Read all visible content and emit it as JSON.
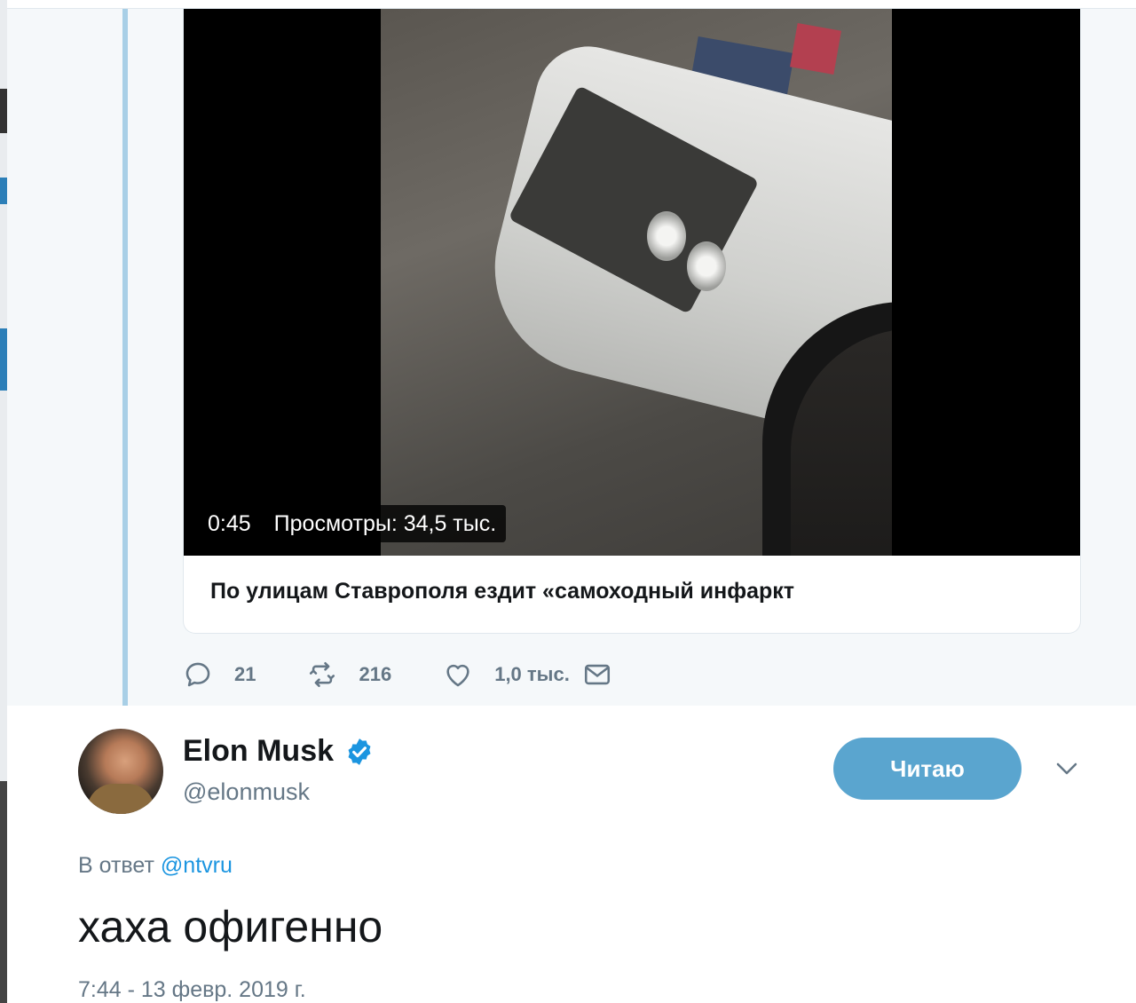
{
  "parent_tweet": {
    "video": {
      "duration": "0:45",
      "views": "Просмотры: 34,5 тыс."
    },
    "card_title": "По улицам Ставрополя ездит «самоходный инфаркт",
    "actions": {
      "replies": "21",
      "retweets": "216",
      "likes": "1,0 тыс."
    }
  },
  "main_tweet": {
    "author_name": "Elon Musk",
    "author_handle": "@elonmusk",
    "follow_label": "Читаю",
    "reply_prefix": "В ответ",
    "reply_mention": "@ntvru",
    "text": "хаха офигенно",
    "timestamp": "7:44 - 13 февр. 2019 г."
  },
  "icons": {
    "reply": "reply-icon",
    "retweet": "retweet-icon",
    "like": "heart-icon",
    "dm": "envelope-icon",
    "verified": "verified-badge-icon",
    "more": "chevron-down-icon"
  },
  "colors": {
    "accent": "#1b95e0",
    "follow_button": "#5aa5cf",
    "thread_line": "#a8cfe6",
    "muted_text": "#657786"
  }
}
